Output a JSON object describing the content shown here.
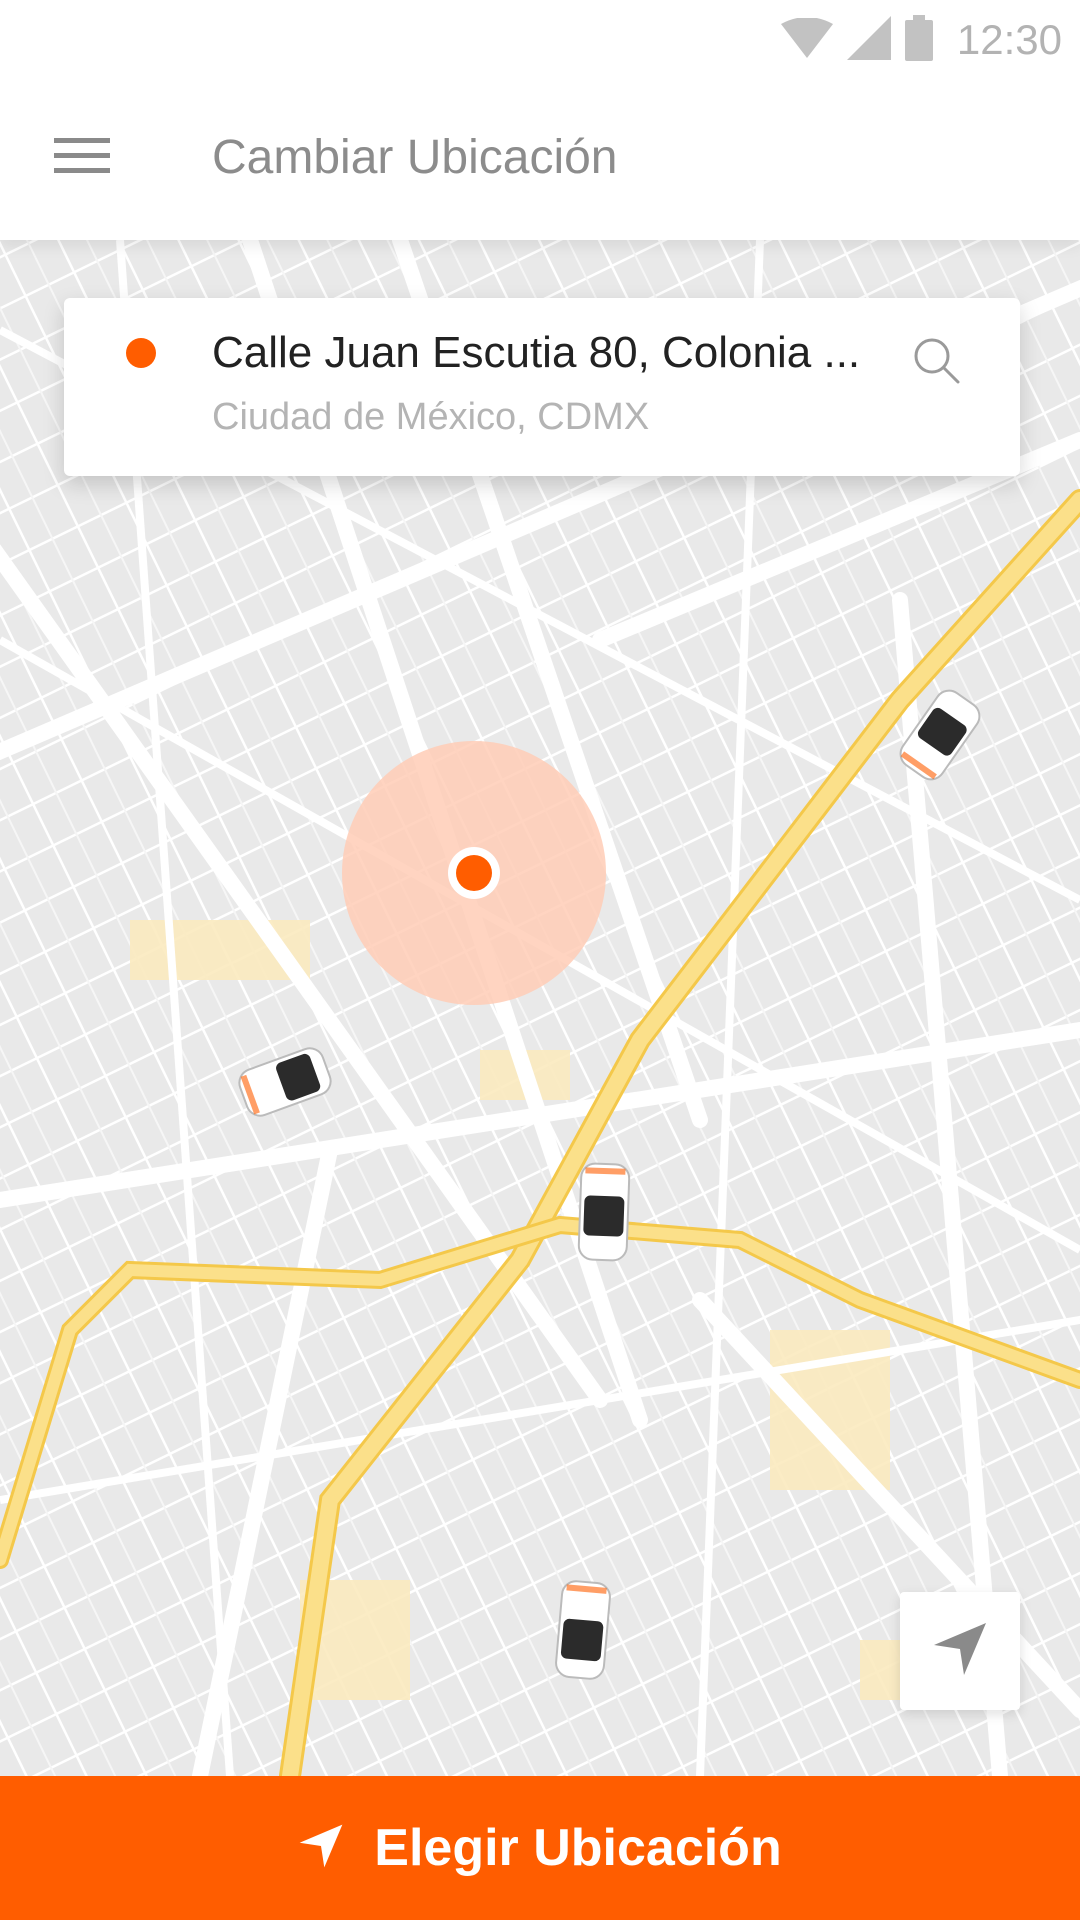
{
  "status_bar": {
    "time": "12:30",
    "icons": [
      "wifi-icon",
      "cell-signal-icon",
      "battery-icon"
    ]
  },
  "app_bar": {
    "menu_icon": "hamburger-menu-icon",
    "title": "Cambiar Ubicación"
  },
  "location_card": {
    "address_line1": "Calle Juan Escutia 80, Colonia ...",
    "address_line2": "Ciudad de México, CDMX",
    "search_icon": "search-icon"
  },
  "map": {
    "vehicles": [
      "car-icon",
      "car-icon",
      "car-icon",
      "car-icon"
    ],
    "pin_icon": "location-pin-icon"
  },
  "recenter": {
    "icon": "navigation-arrow-icon"
  },
  "action_button": {
    "label": "Elegir Ubicación",
    "icon": "navigation-arrow-icon"
  },
  "colors": {
    "accent": "#ff5d00",
    "map_background": "#e9e9e9",
    "road": "#ffffff",
    "highway": "#fbe08a",
    "radius_fill": "#ffd2bf"
  }
}
